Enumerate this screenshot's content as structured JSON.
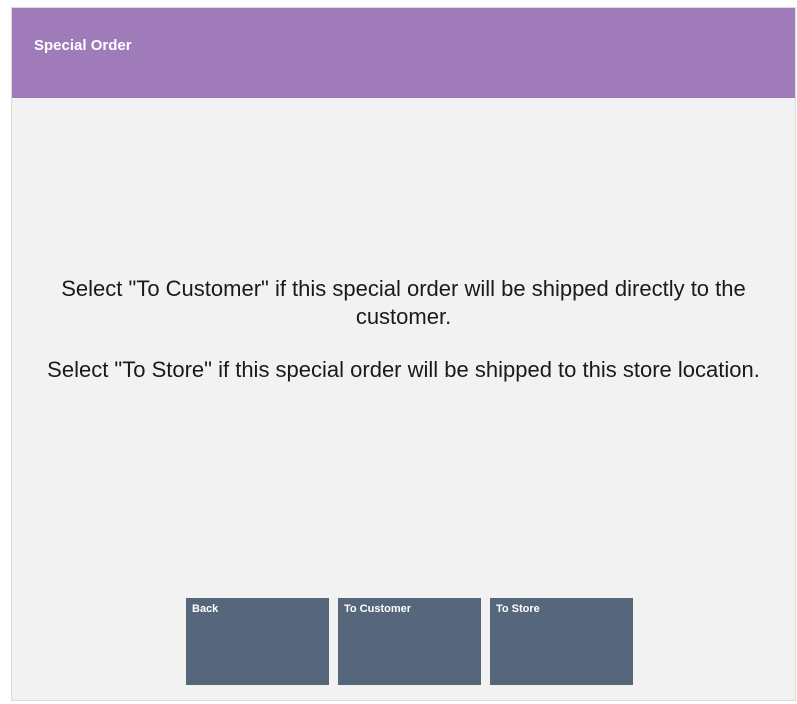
{
  "header": {
    "title": "Special Order"
  },
  "main": {
    "message_lines": [
      "Select \"To Customer\" if this special order will be shipped directly to the customer.",
      "Select \"To Store\" if this special order will be shipped to this store location."
    ]
  },
  "buttons": {
    "back": "Back",
    "to_customer": "To Customer",
    "to_store": "To Store"
  },
  "colors": {
    "title_bar": "#a07bba",
    "button": "#56677b",
    "background": "#f2f2f2"
  }
}
